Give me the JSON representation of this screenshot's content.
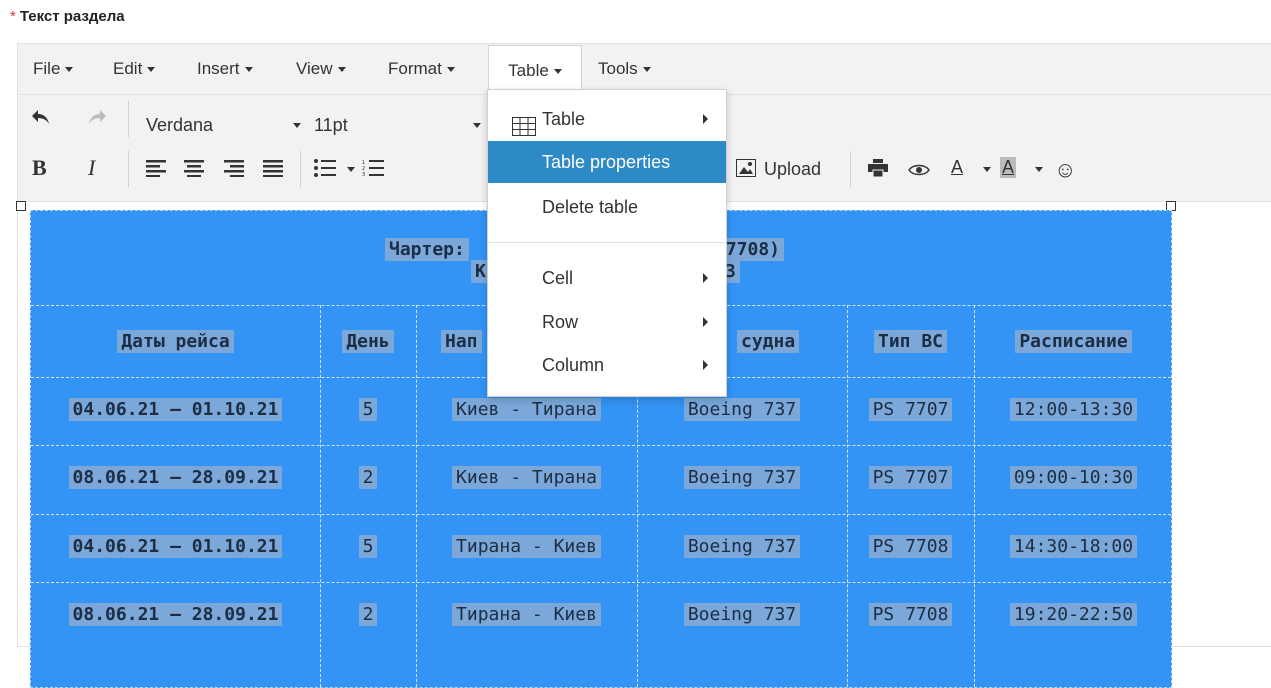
{
  "section": {
    "required_mark": "*",
    "title": "Текст раздела"
  },
  "menubar": {
    "items": [
      "File",
      "Edit",
      "Insert",
      "View",
      "Format",
      "Table",
      "Tools"
    ],
    "active": "Table"
  },
  "toolbar": {
    "font_family": "Verdana",
    "font_size": "11pt",
    "bold": "B",
    "italic": "I",
    "upload_label": "Upload",
    "text_color_label": "A",
    "bg_color_label": "A",
    "icons": [
      "undo-icon",
      "redo-icon",
      "align-left-icon",
      "align-center-icon",
      "align-right-icon",
      "align-justify-icon",
      "bullet-list-icon",
      "numbered-list-icon",
      "image-icon",
      "print-icon",
      "preview-icon",
      "emoji-icon"
    ]
  },
  "table_menu": {
    "items": [
      {
        "label": "Table",
        "submenu": true
      },
      {
        "label": "Table properties",
        "submenu": false,
        "hover": true
      },
      {
        "label": "Delete table",
        "submenu": false
      },
      {
        "label": "Cell",
        "submenu": true
      },
      {
        "label": "Row",
        "submenu": true
      },
      {
        "label": "Column",
        "submenu": true
      }
    ]
  },
  "doc_table": {
    "title_line1_left": "Чартер:",
    "title_line1_right": "S7708)",
    "title_line2_left": "К",
    "title_line2_right": "3",
    "headers": [
      "Даты рейса",
      "День",
      "Нап",
      "судна",
      "Тип ВС",
      "Расписание"
    ],
    "rows": [
      [
        "04.06.21 – 01.10.21",
        "5",
        "Киев - Тирана",
        "Boeing 737",
        "PS 7707",
        "12:00-13:30"
      ],
      [
        "08.06.21 – 28.09.21",
        "2",
        "Киев - Тирана",
        "Boeing 737",
        "PS 7707",
        "09:00-10:30"
      ],
      [
        "04.06.21 – 01.10.21",
        "5",
        "Тирана - Киев",
        "Boeing 737",
        "PS 7708",
        "14:30-18:00"
      ],
      [
        "08.06.21 – 28.09.21",
        "2",
        "Тирана - Киев",
        "Boeing 737",
        "PS 7708",
        "19:20-22:50"
      ]
    ]
  },
  "colors": {
    "table_bg": "#3394f5",
    "menu_hover": "#2d8ac7",
    "required": "#e0342b"
  }
}
